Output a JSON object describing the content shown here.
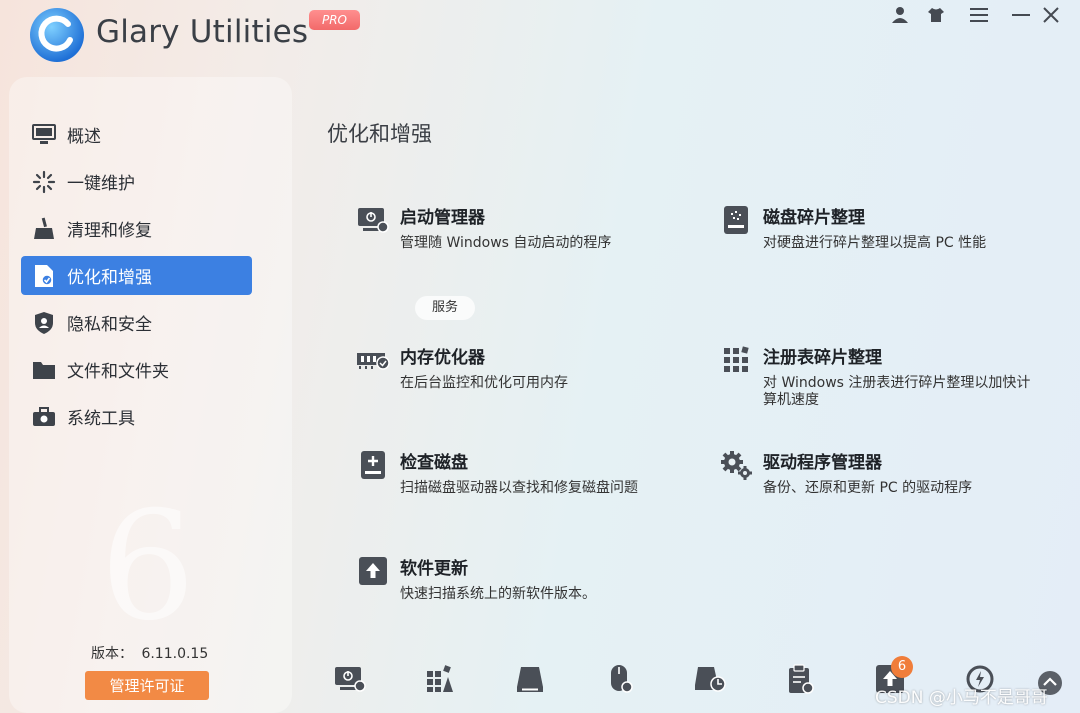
{
  "app": {
    "title": "Glary Utilities",
    "edition_badge": "PRO",
    "window_controls": [
      "user-icon",
      "tshirt-icon",
      "menu-icon",
      "minimize-icon",
      "close-icon"
    ]
  },
  "sidebar": {
    "items": [
      {
        "label": "概述",
        "icon": "monitor-icon"
      },
      {
        "label": "一键维护",
        "icon": "sparkle-icon"
      },
      {
        "label": "清理和修复",
        "icon": "broom-icon"
      },
      {
        "label": "优化和增强",
        "icon": "optimize-doc-icon",
        "active": true
      },
      {
        "label": "隐私和安全",
        "icon": "shield-icon"
      },
      {
        "label": "文件和文件夹",
        "icon": "folder-icon"
      },
      {
        "label": "系统工具",
        "icon": "toolbox-icon"
      }
    ],
    "version_label": "版本：",
    "version_value": "6.11.0.15",
    "license_button": "管理许可证",
    "background_numeral": "6"
  },
  "main": {
    "title": "优化和增强",
    "services_button": "服务",
    "cards": [
      {
        "title": "启动管理器",
        "desc": "管理随 Windows 自动启动的程序",
        "icon": "startup-icon"
      },
      {
        "title": "磁盘碎片整理",
        "desc": "对硬盘进行碎片整理以提高 PC 性能",
        "icon": "disk-defrag-icon"
      },
      {
        "title": "内存优化器",
        "desc": "在后台监控和优化可用内存",
        "icon": "memory-icon"
      },
      {
        "title": "注册表碎片整理",
        "desc": "对 Windows 注册表进行碎片整理以加快计算机速度",
        "icon": "registry-icon"
      },
      {
        "title": "检查磁盘",
        "desc": "扫描磁盘驱动器以查找和修复磁盘问题",
        "icon": "check-disk-icon"
      },
      {
        "title": "驱动程序管理器",
        "desc": "备份、还原和更新 PC 的驱动程序",
        "icon": "gears-icon"
      },
      {
        "title": "软件更新",
        "desc": "快速扫描系统上的新软件版本。",
        "icon": "update-icon"
      }
    ]
  },
  "toolbar": {
    "icons": [
      "startup-icon",
      "registry-icon",
      "disk-icon",
      "mouse-icon",
      "disk-space-icon",
      "clipboard-icon",
      "update-icon",
      "speed-icon",
      "scroll-up-icon"
    ],
    "update_badge": "6"
  },
  "watermark": "CSDN @小马不是哥哥",
  "colors": {
    "accent": "#3c80e2",
    "license_button": "#f28a45",
    "pro_badge": "#f26a6a"
  }
}
